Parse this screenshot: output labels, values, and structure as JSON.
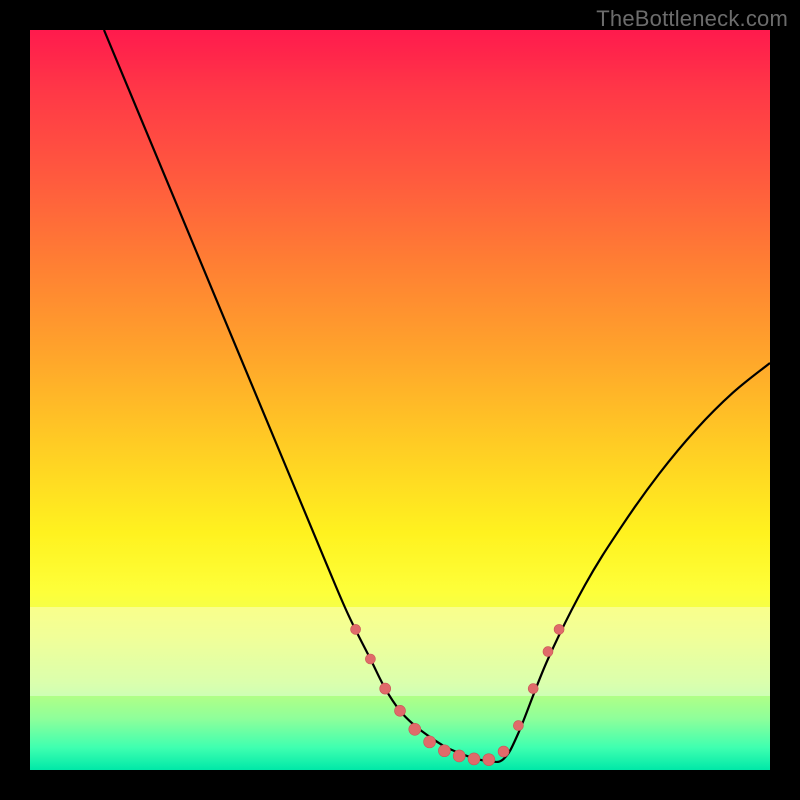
{
  "watermark": "TheBottleneck.com",
  "chart_data": {
    "type": "line",
    "title": "",
    "xlabel": "",
    "ylabel": "",
    "xlim": [
      0,
      100
    ],
    "ylim": [
      0,
      100
    ],
    "series": [
      {
        "name": "curve",
        "x": [
          10,
          15,
          20,
          25,
          30,
          35,
          40,
          43,
          46,
          48,
          50,
          52,
          54,
          56,
          58,
          60,
          62,
          64,
          66,
          70,
          75,
          80,
          85,
          90,
          95,
          100
        ],
        "y": [
          100,
          88,
          76,
          64,
          52,
          40,
          28,
          21,
          15,
          11,
          8,
          6,
          4.5,
          3.2,
          2.3,
          1.6,
          1.2,
          1.5,
          5,
          15,
          25,
          33,
          40,
          46,
          51,
          55
        ]
      }
    ],
    "markers": {
      "name": "highlight-points",
      "color": "#e06a6a",
      "points": [
        {
          "x": 44,
          "y": 19,
          "r": 5
        },
        {
          "x": 46,
          "y": 15,
          "r": 5
        },
        {
          "x": 48,
          "y": 11,
          "r": 5.5
        },
        {
          "x": 50,
          "y": 8,
          "r": 5.5
        },
        {
          "x": 52,
          "y": 5.5,
          "r": 6
        },
        {
          "x": 54,
          "y": 3.8,
          "r": 6
        },
        {
          "x": 56,
          "y": 2.6,
          "r": 6
        },
        {
          "x": 58,
          "y": 1.9,
          "r": 6
        },
        {
          "x": 60,
          "y": 1.5,
          "r": 6
        },
        {
          "x": 62,
          "y": 1.4,
          "r": 6
        },
        {
          "x": 64,
          "y": 2.5,
          "r": 5.5
        },
        {
          "x": 66,
          "y": 6,
          "r": 5
        },
        {
          "x": 68,
          "y": 11,
          "r": 5
        },
        {
          "x": 70,
          "y": 16,
          "r": 5
        },
        {
          "x": 71.5,
          "y": 19,
          "r": 5
        }
      ]
    },
    "pale_band": {
      "y_top": 22,
      "y_bottom": 10
    }
  }
}
